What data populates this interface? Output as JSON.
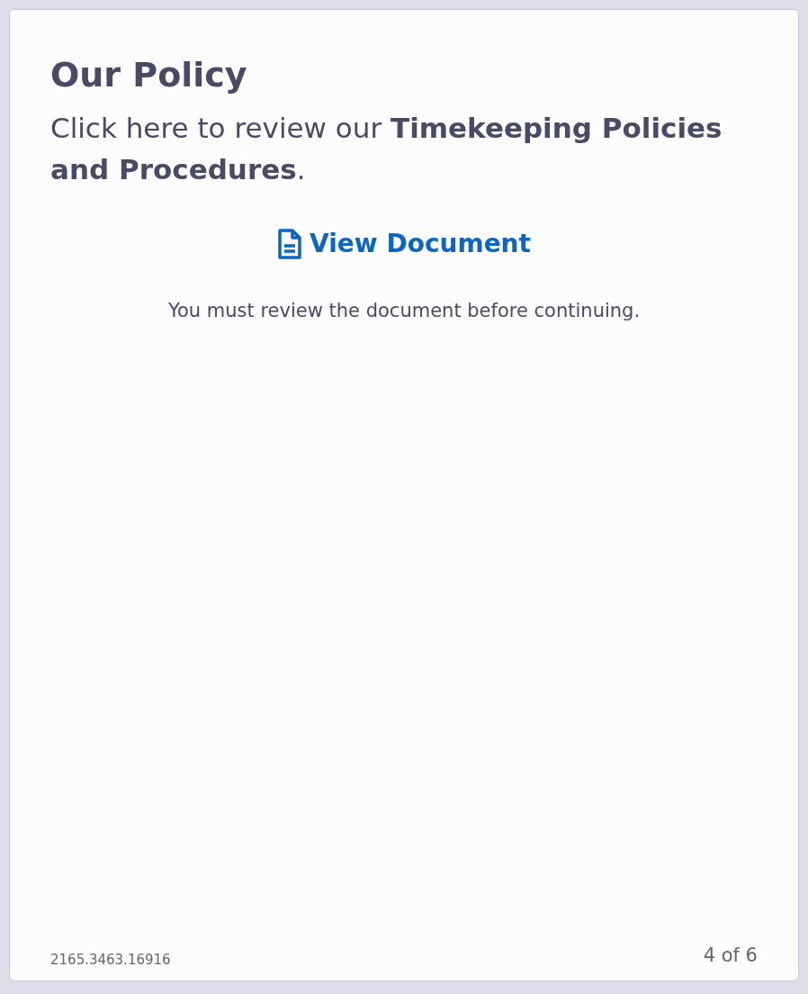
{
  "card": {
    "title": "Our Policy",
    "intro": "Click here to review our **Timekeeping Policies and Procedures**.",
    "link": {
      "label": "View Document"
    },
    "note": "You must review the document before continuing.",
    "footer": {
      "code": "2165.3463.16916",
      "page": "4 of 6"
    }
  }
}
